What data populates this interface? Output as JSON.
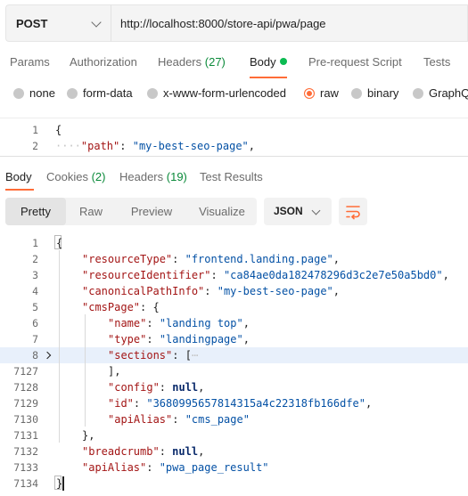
{
  "request": {
    "method": "POST",
    "url": "http://localhost:8000/store-api/pwa/page"
  },
  "request_tabs": {
    "params": "Params",
    "authorization": "Authorization",
    "headers": "Headers",
    "headers_count": "(27)",
    "body": "Body",
    "prerequest": "Pre-request Script",
    "tests": "Tests"
  },
  "body_types": {
    "none": "none",
    "form_data": "form-data",
    "urlencoded": "x-www-form-urlencoded",
    "raw": "raw",
    "binary": "binary",
    "graphql": "GraphQ"
  },
  "request_body": {
    "lines": [
      {
        "num": "1",
        "open": "{"
      },
      {
        "num": "2",
        "key": "\"path\"",
        "colon": ": ",
        "value": "\"my-best-seo-page\"",
        "tail": ","
      }
    ]
  },
  "response_tabs": {
    "body": "Body",
    "cookies": "Cookies",
    "cookies_count": "(2)",
    "headers": "Headers",
    "headers_count": "(19)",
    "test_results": "Test Results"
  },
  "view": {
    "pretty": "Pretty",
    "raw": "Raw",
    "preview": "Preview",
    "visualize": "Visualize",
    "format": "JSON"
  },
  "response_body": {
    "l1": {
      "num": "1",
      "text": "{"
    },
    "l2": {
      "num": "2",
      "key": "\"resourceType\"",
      "value": "\"frontend.landing.page\"",
      "tail": ","
    },
    "l3": {
      "num": "3",
      "key": "\"resourceIdentifier\"",
      "value": "\"ca84ae0da182478296d3c2e7e50a5bd0\"",
      "tail": ","
    },
    "l4": {
      "num": "4",
      "key": "\"canonicalPathInfo\"",
      "value": "\"my-best-seo-page\"",
      "tail": ","
    },
    "l5": {
      "num": "5",
      "key": "\"cmsPage\"",
      "value": "{",
      "tail": ""
    },
    "l6": {
      "num": "6",
      "key": "\"name\"",
      "value": "\"landing top\"",
      "tail": ","
    },
    "l7": {
      "num": "7",
      "key": "\"type\"",
      "value": "\"landingpage\"",
      "tail": ","
    },
    "l8": {
      "num": "8",
      "key": "\"sections\"",
      "value": "[",
      "tail": "⋯"
    },
    "l9": {
      "num": "7127",
      "text": "],"
    },
    "l10": {
      "num": "7128",
      "key": "\"config\"",
      "value": "null",
      "tail": ","
    },
    "l11": {
      "num": "7129",
      "key": "\"id\"",
      "value": "\"3680995657814315a4c22318fb166dfe\"",
      "tail": ","
    },
    "l12": {
      "num": "7130",
      "key": "\"apiAlias\"",
      "value": "\"cms_page\"",
      "tail": ""
    },
    "l13": {
      "num": "7131",
      "text": "},"
    },
    "l14": {
      "num": "7132",
      "key": "\"breadcrumb\"",
      "value": "null",
      "tail": ","
    },
    "l15": {
      "num": "7133",
      "key": "\"apiAlias\"",
      "value": "\"pwa_page_result\"",
      "tail": ""
    },
    "l16": {
      "num": "7134",
      "text": "}"
    }
  }
}
